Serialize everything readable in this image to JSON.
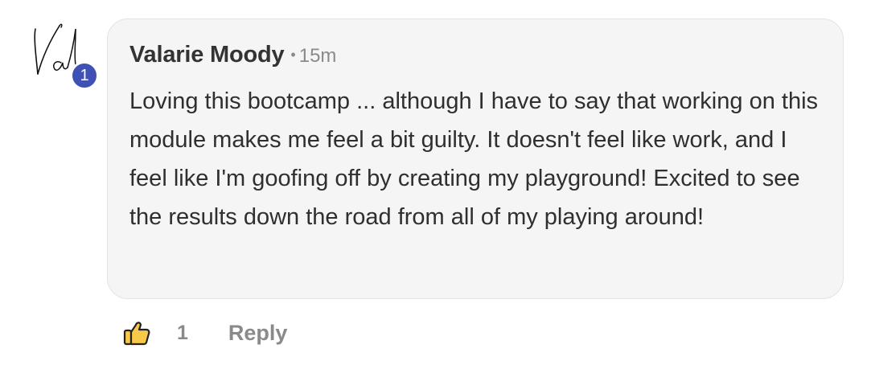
{
  "comment": {
    "avatar": {
      "signature_text": "Val",
      "level_badge": "1",
      "badge_color": "#3f51b5"
    },
    "author_name": "Valarie Moody",
    "separator": "•",
    "timestamp": "15m",
    "body": "Loving this bootcamp ... although I have to say that working on this module makes me feel a bit guilty. It doesn't feel like work, and I feel like I'm goofing off by creating my playground! Excited to see the results down the road from all of my playing around!",
    "actions": {
      "like_icon": "thumbs-up-icon",
      "like_count": "1",
      "reply_label": "Reply"
    }
  }
}
